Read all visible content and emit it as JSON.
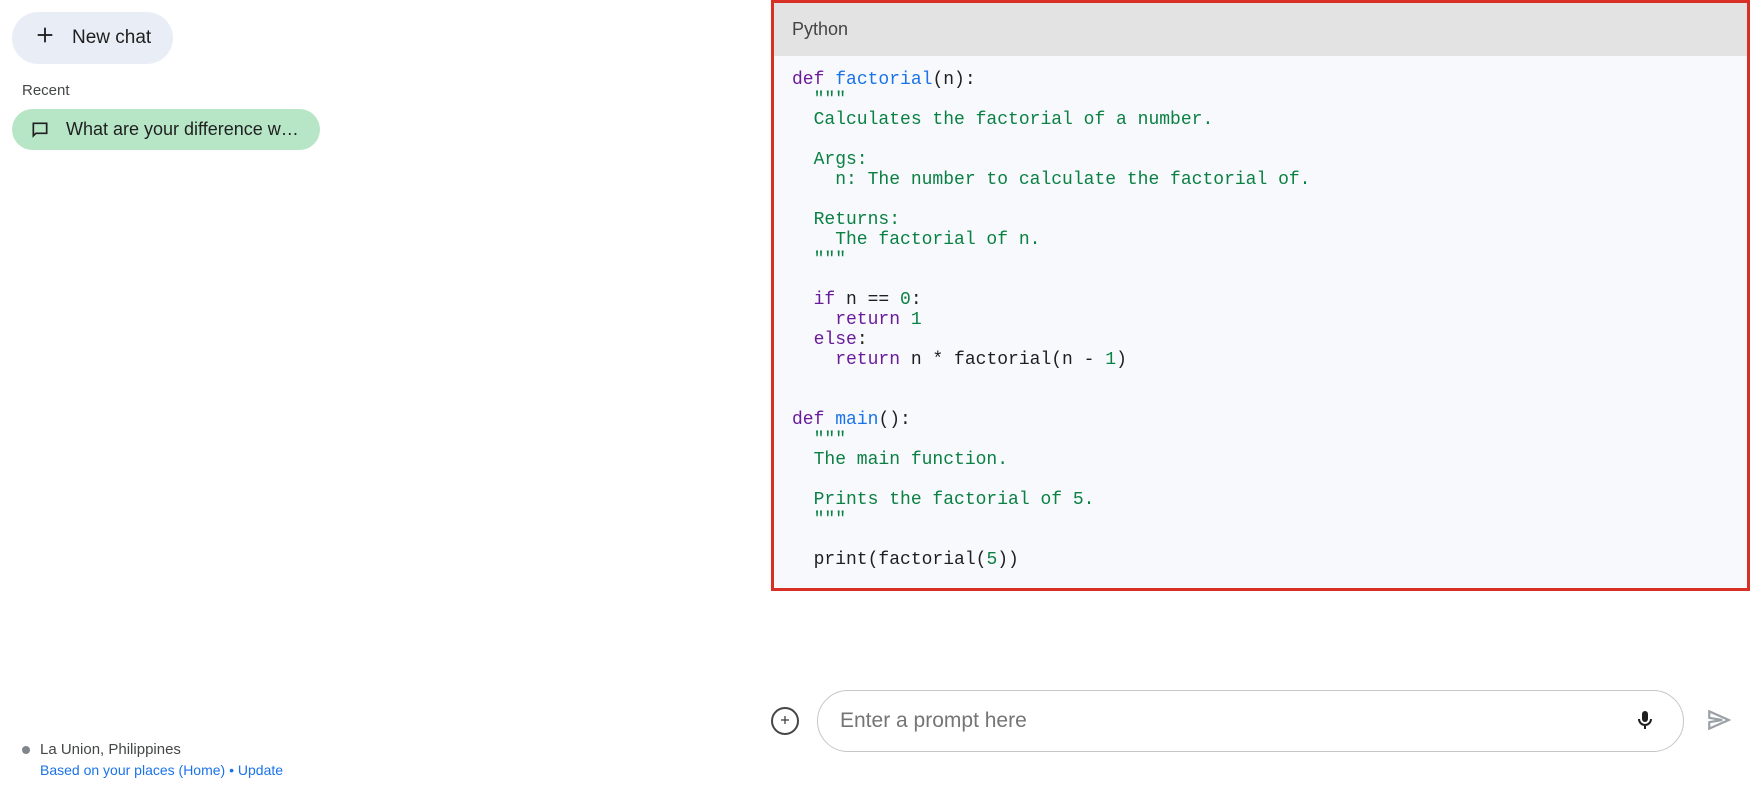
{
  "sidebar": {
    "new_chat_label": "New chat",
    "recent_label": "Recent",
    "active_chat_label": "What are your difference with ...",
    "location": "La Union, Philippines",
    "location_sub": "Based on your places (Home) • Update"
  },
  "code_block": {
    "language_label": "Python",
    "tokens": [
      [
        {
          "t": "def ",
          "c": "kw"
        },
        {
          "t": "factorial",
          "c": "fn"
        },
        {
          "t": "(n):",
          "c": "plain"
        }
      ],
      [
        {
          "t": "  \"\"\"",
          "c": "str"
        }
      ],
      [
        {
          "t": "  Calculates the factorial of a number.",
          "c": "str"
        }
      ],
      [
        {
          "t": "",
          "c": "plain"
        }
      ],
      [
        {
          "t": "  Args:",
          "c": "str"
        }
      ],
      [
        {
          "t": "    n: The number to calculate the factorial of.",
          "c": "str"
        }
      ],
      [
        {
          "t": "",
          "c": "plain"
        }
      ],
      [
        {
          "t": "  Returns:",
          "c": "str"
        }
      ],
      [
        {
          "t": "    The factorial of n.",
          "c": "str"
        }
      ],
      [
        {
          "t": "  \"\"\"",
          "c": "str"
        }
      ],
      [
        {
          "t": "",
          "c": "plain"
        }
      ],
      [
        {
          "t": "  if ",
          "c": "kw"
        },
        {
          "t": "n == ",
          "c": "plain"
        },
        {
          "t": "0",
          "c": "num"
        },
        {
          "t": ":",
          "c": "plain"
        }
      ],
      [
        {
          "t": "    return ",
          "c": "kw"
        },
        {
          "t": "1",
          "c": "num"
        }
      ],
      [
        {
          "t": "  else",
          "c": "kw"
        },
        {
          "t": ":",
          "c": "plain"
        }
      ],
      [
        {
          "t": "    return ",
          "c": "kw"
        },
        {
          "t": "n * factorial(n - ",
          "c": "plain"
        },
        {
          "t": "1",
          "c": "num"
        },
        {
          "t": ")",
          "c": "plain"
        }
      ],
      [
        {
          "t": "",
          "c": "plain"
        }
      ],
      [
        {
          "t": "",
          "c": "plain"
        }
      ],
      [
        {
          "t": "def ",
          "c": "kw"
        },
        {
          "t": "main",
          "c": "fn"
        },
        {
          "t": "():",
          "c": "plain"
        }
      ],
      [
        {
          "t": "  \"\"\"",
          "c": "str"
        }
      ],
      [
        {
          "t": "  The main function.",
          "c": "str"
        }
      ],
      [
        {
          "t": "",
          "c": "plain"
        }
      ],
      [
        {
          "t": "  Prints the factorial of 5.",
          "c": "str"
        }
      ],
      [
        {
          "t": "  \"\"\"",
          "c": "str"
        }
      ],
      [
        {
          "t": "",
          "c": "plain"
        }
      ],
      [
        {
          "t": "  print(factorial(",
          "c": "plain"
        },
        {
          "t": "5",
          "c": "num"
        },
        {
          "t": "))",
          "c": "plain"
        }
      ]
    ]
  },
  "input": {
    "placeholder": "Enter a prompt here"
  }
}
